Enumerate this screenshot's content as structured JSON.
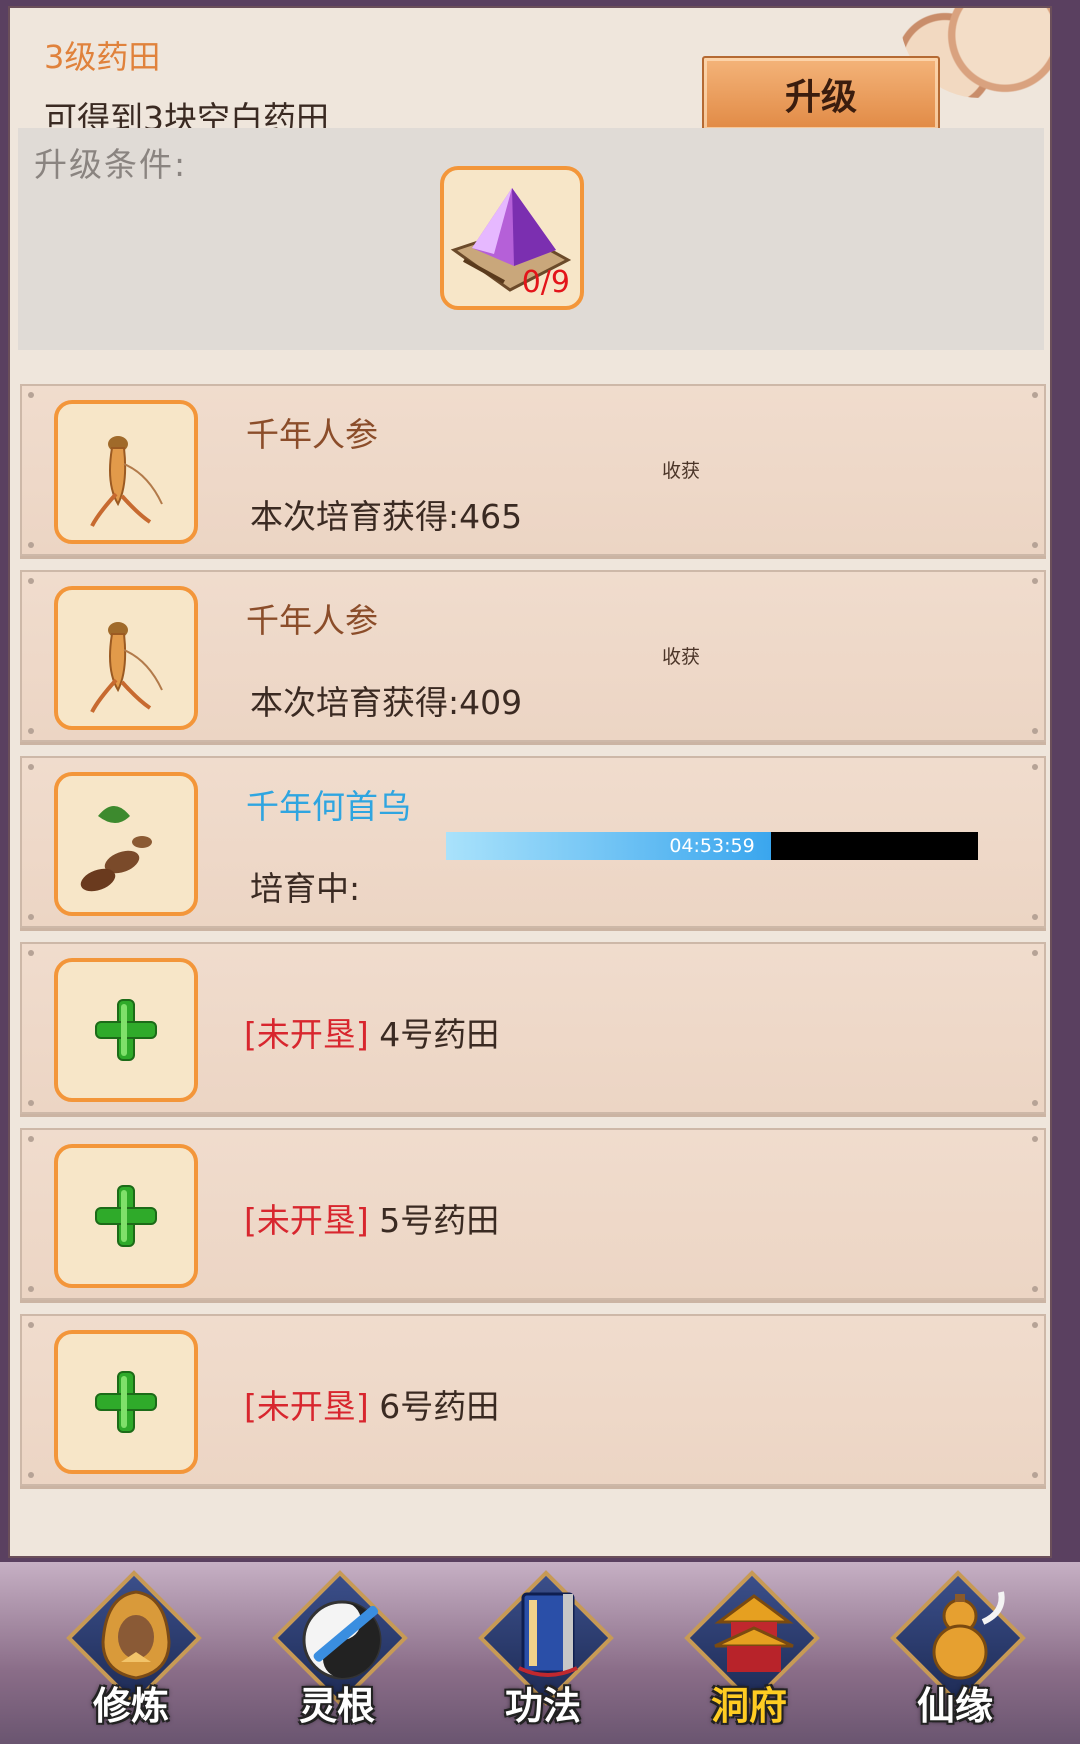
{
  "header": {
    "level_title": "3级药田",
    "description": "可得到3块空白药田",
    "upgrade_label": "升级"
  },
  "conditions": {
    "label": "升级条件:",
    "item_count": "0/9"
  },
  "fields": [
    {
      "name": "千年人参",
      "yield_label": "本次培育获得:",
      "yield_value": "465",
      "action": "收获"
    },
    {
      "name": "千年人参",
      "yield_label": "本次培育获得:",
      "yield_value": "409",
      "action": "收获"
    },
    {
      "name": "千年何首乌",
      "status": "培育中:",
      "timer": "04:53:59",
      "progress": 0.61
    }
  ],
  "unopened": [
    {
      "tag": "[未开垦]",
      "name": "4号药田"
    },
    {
      "tag": "[未开垦]",
      "name": "5号药田"
    },
    {
      "tag": "[未开垦]",
      "name": "6号药田"
    }
  ],
  "nav": [
    {
      "label": "修炼",
      "icon": "hooded-monk-icon"
    },
    {
      "label": "灵根",
      "icon": "taiji-sword-icon"
    },
    {
      "label": "功法",
      "icon": "book-icon"
    },
    {
      "label": "洞府",
      "icon": "pagoda-icon",
      "active": true
    },
    {
      "label": "仙缘",
      "icon": "gourd-icon"
    }
  ],
  "colors": {
    "accent": "#f3963a",
    "level_title": "#e0823c",
    "unopened_tag": "#d8262e",
    "growing_name": "#2fa5e0",
    "nav_active": "#ffcc22"
  }
}
